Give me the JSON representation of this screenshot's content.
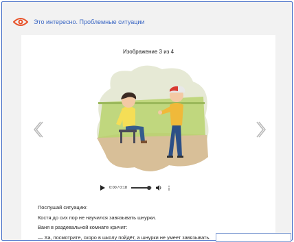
{
  "header": {
    "title": "Это интересно. Проблемные ситуации",
    "icon": "eye-icon",
    "accent_color": "#3a66c4",
    "icon_color": "#e8532a"
  },
  "gallery": {
    "counter": "Изображение 3 из 4",
    "prev_icon": "chevron-left-icon",
    "next_icon": "chevron-right-icon"
  },
  "audio": {
    "time": "0:00 / 0:18",
    "progress": 0.85,
    "play_icon": "play-icon",
    "volume_icon": "volume-icon",
    "menu_icon": "more-vertical-icon"
  },
  "text": {
    "lines": [
      "Послушай ситуацию:",
      "Костя до сих пор не научился завязывать шнурки.",
      "Ваня в раздевальной комнате кричит:",
      "— Ха, посмотрите, скоро в школу пойдёт, а шнурки не умеет завязывать."
    ]
  }
}
